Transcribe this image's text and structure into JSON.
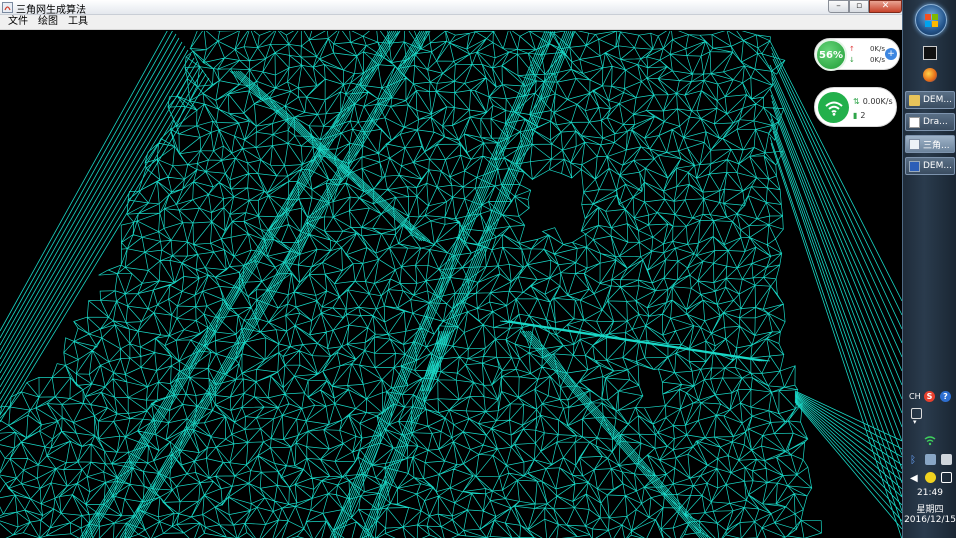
{
  "window": {
    "title": "三角网生成算法",
    "controls": {
      "minimize": "–",
      "maximize": "▫",
      "close": "✕"
    }
  },
  "menu": {
    "items": [
      {
        "label": "文件"
      },
      {
        "label": "绘图"
      },
      {
        "label": "工具"
      }
    ]
  },
  "canvas": {
    "background": "#000000",
    "mesh_color": "#19d7c6",
    "content": "triangulated irregular network mesh"
  },
  "speed_widget": {
    "cpu_percent": "56%",
    "upload": "0K/s",
    "download": "0K/s",
    "up_arrow": "↑",
    "down_arrow": "↓",
    "add_icon": "+"
  },
  "wifi_widget": {
    "speed": "0.00K/s",
    "devices": "2",
    "icon": "wifi-icon"
  },
  "taskbar": {
    "tasks": [
      {
        "label": "DEM...",
        "icon": "folder-icon",
        "active": false
      },
      {
        "label": "Dra...",
        "icon": "drawing-app-icon",
        "active": false
      },
      {
        "label": "三角...",
        "icon": "java-app-icon",
        "active": true
      },
      {
        "label": "DEM...",
        "icon": "word-doc-icon",
        "active": false
      }
    ],
    "tray": {
      "language": "CH",
      "sogou": "S",
      "help": "?",
      "expand": "▾",
      "bluetooth": "ᛒ",
      "volume": "◀"
    },
    "clock": {
      "time": "21:49",
      "day": "星期四",
      "date": "2016/12/15"
    }
  }
}
